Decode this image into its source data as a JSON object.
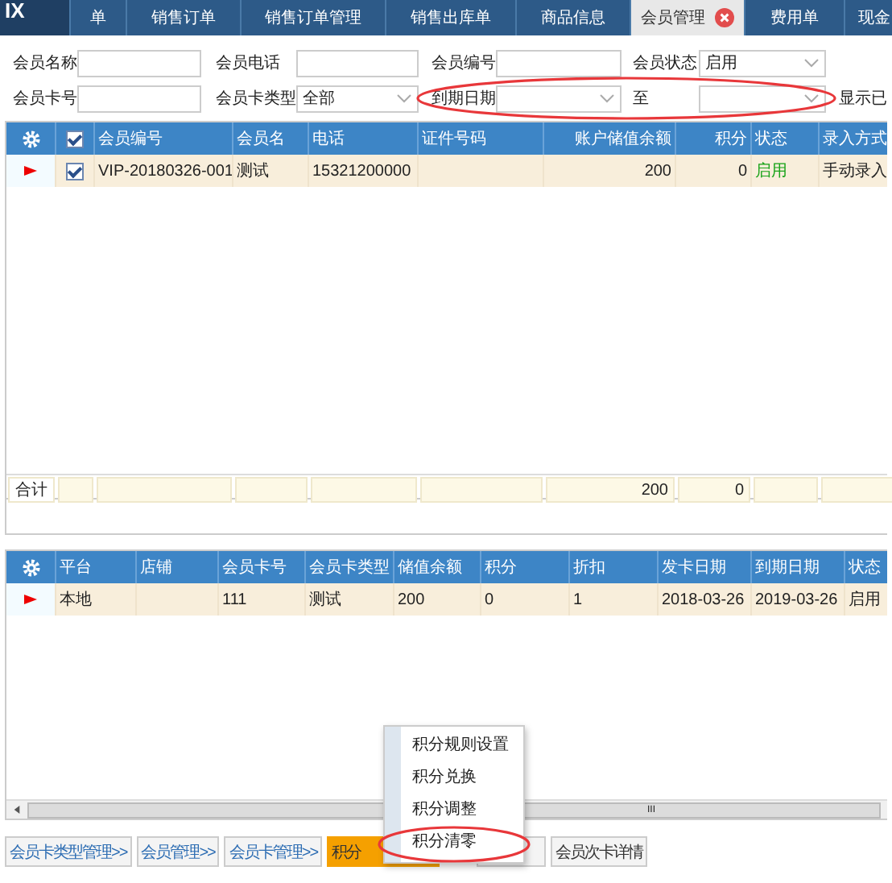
{
  "logo": "IX",
  "tabs": [
    {
      "label": "单",
      "selected": false,
      "closable": false
    },
    {
      "label": "销售订单",
      "selected": false,
      "closable": false
    },
    {
      "label": "销售订单管理",
      "selected": false,
      "closable": false
    },
    {
      "label": "销售出库单",
      "selected": false,
      "closable": false
    },
    {
      "label": "商品信息",
      "selected": false,
      "closable": false
    },
    {
      "label": "会员管理",
      "selected": true,
      "closable": true
    },
    {
      "label": "费用单",
      "selected": false,
      "closable": false
    },
    {
      "label": "现金",
      "selected": false,
      "closable": false
    }
  ],
  "filters": [
    [
      {
        "label": "会员名称",
        "kind": "input"
      },
      {
        "label": "会员电话",
        "kind": "input"
      },
      {
        "label": "会员编号",
        "kind": "input"
      },
      {
        "label": "会员状态",
        "kind": "select",
        "value": "启用"
      }
    ],
    [
      {
        "label": "会员卡号",
        "kind": "input"
      },
      {
        "label": "会员卡类型",
        "kind": "select",
        "value": "全部"
      },
      {
        "label": "到期日期",
        "kind": "select"
      },
      {
        "label": "至",
        "kind": "select"
      }
    ]
  ],
  "show_deleted": "显示已",
  "members": {
    "columns": [
      "会员编号",
      "会员名",
      "电话",
      "证件号码",
      "账户储值余额",
      "积分",
      "状态",
      "录入方式"
    ],
    "header_checked": true,
    "rows": [
      {
        "current": true,
        "checked": true,
        "cells": [
          "VIP-20180326-001",
          "测试",
          "15321200000",
          "",
          "200",
          "0",
          "启用",
          "手动录入"
        ]
      }
    ],
    "footer": {
      "label": "合计",
      "balance": "200",
      "points": "0"
    }
  },
  "cards": {
    "columns": [
      "平台",
      "店铺",
      "会员卡号",
      "会员卡类型",
      "储值余额",
      "积分",
      "折扣",
      "发卡日期",
      "到期日期",
      "状态"
    ],
    "rows": [
      {
        "current": true,
        "cells": [
          "本地",
          "",
          "111",
          "测试",
          "200",
          "0",
          "1",
          "2018-03-26",
          "2019-03-26",
          "启用"
        ]
      }
    ]
  },
  "scrollbar_grip": "III",
  "buttons": [
    {
      "label": "会员卡类型管理>>",
      "kind": "link"
    },
    {
      "label": "会员管理>>",
      "kind": "link"
    },
    {
      "label": "会员卡管理>>",
      "kind": "link"
    },
    {
      "label": "积分",
      "kind": "accent"
    },
    {
      "kind": "plain"
    },
    {
      "label": "会员次卡详情",
      "kind": "plain"
    }
  ],
  "menu": [
    {
      "label": "积分规则设置"
    },
    {
      "label": "积分兑换"
    },
    {
      "label": "积分调整"
    },
    {
      "label": "积分清零"
    }
  ]
}
